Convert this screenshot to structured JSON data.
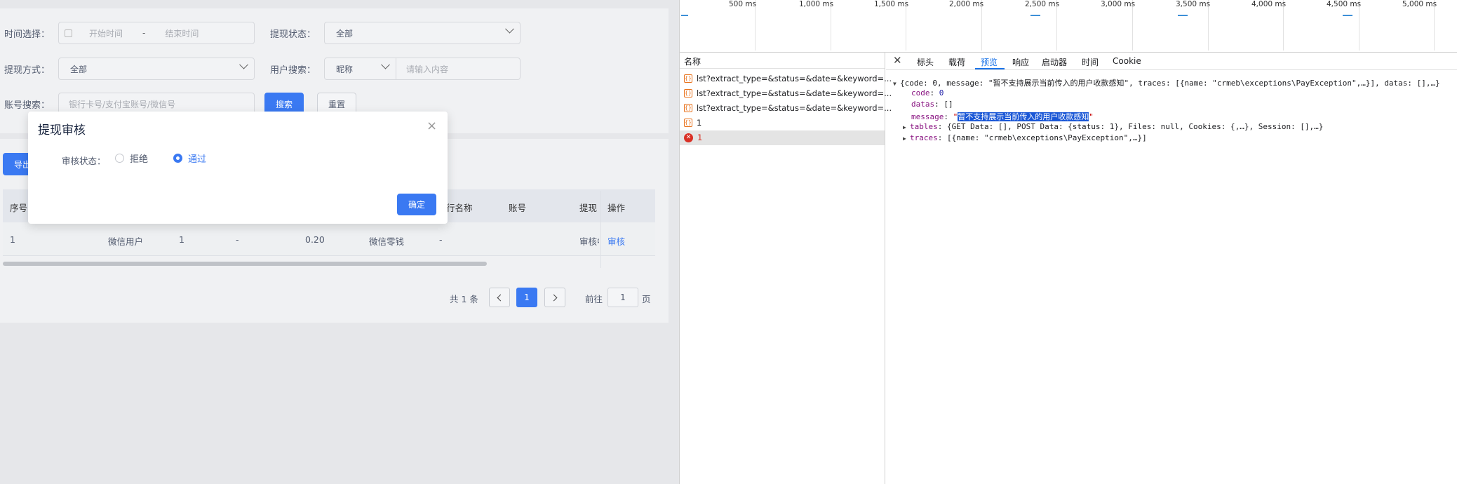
{
  "filters": {
    "time_label": "时间选择：",
    "time_start_placeholder": "开始时间",
    "time_sep": "-",
    "time_end_placeholder": "结束时间",
    "status_label": "提现状态：",
    "status_value": "全部",
    "method_label": "提现方式：",
    "method_value": "全部",
    "user_search_label": "用户搜索：",
    "user_search_type": "昵称",
    "user_search_placeholder": "请输入内容",
    "account_label": "账号搜索：",
    "account_placeholder": "银行卡号/支付宝账号/微信号",
    "search_button": "搜索",
    "reset_button": "重置"
  },
  "export_button": "导出",
  "table": {
    "headers": [
      "序号",
      "行名称",
      "账号",
      "提现",
      "操作"
    ],
    "row": {
      "index": "1",
      "user_type": "微信用户",
      "num": "1",
      "dash1": "-",
      "amount": "0.20",
      "method": "微信零钱",
      "dash2": "-",
      "status": "审核中",
      "action": "审核"
    }
  },
  "pagination": {
    "total": "共 1 条",
    "current": "1",
    "goto_label": "前往",
    "goto_value": "1",
    "page_suffix": "页"
  },
  "modal": {
    "title": "提现审核",
    "field_label": "审核状态：",
    "option_reject": "拒绝",
    "option_pass": "通过",
    "selected": "通过",
    "confirm_button": "确定"
  },
  "devtools": {
    "timeline_ticks": [
      "500 ms",
      "1,000 ms",
      "1,500 ms",
      "2,000 ms",
      "2,500 ms",
      "3,000 ms",
      "3,500 ms",
      "4,000 ms",
      "4,500 ms",
      "5,000 ms"
    ],
    "name_header": "名称",
    "requests": [
      {
        "name": "lst?extract_type=&status=&date=&keyword=...",
        "type": "xhr"
      },
      {
        "name": "lst?extract_type=&status=&date=&keyword=...",
        "type": "xhr"
      },
      {
        "name": "lst?extract_type=&status=&date=&keyword=...",
        "type": "xhr"
      },
      {
        "name": "1",
        "type": "xhr"
      },
      {
        "name": "1",
        "type": "error"
      }
    ],
    "tabs": [
      "标头",
      "载荷",
      "预览",
      "响应",
      "启动器",
      "时间",
      "Cookie"
    ],
    "active_tab": "预览",
    "preview": {
      "summary": "{code: 0, message: \"暂不支持展示当前传入的用户收款感知\", traces: [{name: \"crmeb\\exceptions\\PayException\",…}], datas: [],…}",
      "code_key": "code",
      "code_val": "0",
      "datas_key": "datas",
      "datas_val": "[]",
      "message_key": "message",
      "message_val": "暂不支持展示当前传入的用户收款感知",
      "tables_key": "tables",
      "tables_val": "{GET Data: [], POST Data: {status: 1}, Files: null, Cookies: {,…}, Session: [],…}",
      "traces_key": "traces",
      "traces_val": "[{name: \"crmeb\\exceptions\\PayException\",…}]"
    }
  }
}
